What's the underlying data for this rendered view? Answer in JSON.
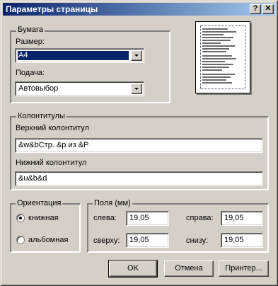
{
  "window": {
    "title": "Параметры страницы",
    "help_button": "?",
    "close_button": "✕"
  },
  "paper": {
    "group_label": "Бумага",
    "size_label": "Размер:",
    "size_value": "A4",
    "source_label": "Подача:",
    "source_value": "Автовыбор"
  },
  "headers": {
    "group_label": "Колонтитулы",
    "header_label": "Верхний колонтитул",
    "header_value": "&w&bСтр. &p из &P",
    "footer_label": "Нижний колонтитул",
    "footer_value": "&u&b&d"
  },
  "orientation": {
    "group_label": "Ориентация",
    "portrait_label": "книжная",
    "landscape_label": "альбомная",
    "selected": "portrait"
  },
  "margins": {
    "group_label": "Поля (мм)",
    "left_label": "слева:",
    "left_value": "19,05",
    "right_label": "справа:",
    "right_value": "19,05",
    "top_label": "сверху:",
    "top_value": "19,05",
    "bottom_label": "снизу:",
    "bottom_value": "19,05"
  },
  "buttons": {
    "ok": "OK",
    "cancel": "Отмена",
    "printer": "Принтер..."
  },
  "colors": {
    "titlebar_start": "#0a246a",
    "titlebar_end": "#a6caf0",
    "face": "#d4d0c8",
    "selection": "#0a246a"
  }
}
